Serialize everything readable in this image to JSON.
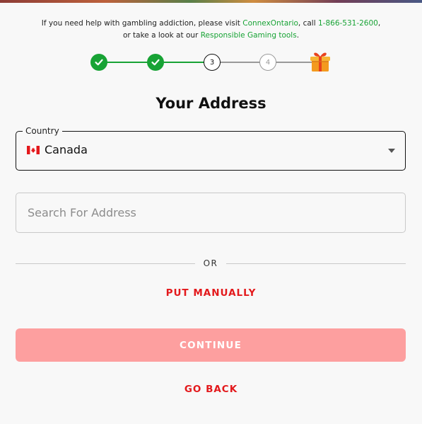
{
  "help": {
    "text_1": "If you need help with gambling addiction, please visit ",
    "link_1": "ConnexOntario",
    "text_2": ", call ",
    "link_2": "1-866-531-2600",
    "text_3": ",",
    "text_4": "or take a look at our ",
    "link_3": "Responsible Gaming tools",
    "text_5": "."
  },
  "stepper": {
    "steps": [
      {
        "label": "",
        "state": "done",
        "icon": "check-icon"
      },
      {
        "label": "",
        "state": "done",
        "icon": "check-icon"
      },
      {
        "label": "3",
        "state": "current"
      },
      {
        "label": "4",
        "state": "todo"
      }
    ],
    "final_icon": "gift-icon"
  },
  "title": "Your Address",
  "country": {
    "label": "Country",
    "value": "Canada",
    "flag_icon": "canada-flag-icon"
  },
  "search": {
    "placeholder": "Search For Address",
    "value": ""
  },
  "divider_text": "OR",
  "put_manually_label": "PUT MANUALLY",
  "continue_label": "CONTINUE",
  "go_back_label": "GO BACK",
  "colors": {
    "accent_green": "#18a335",
    "accent_red": "#e3191c",
    "continue_disabled": "#fd9f9f"
  }
}
